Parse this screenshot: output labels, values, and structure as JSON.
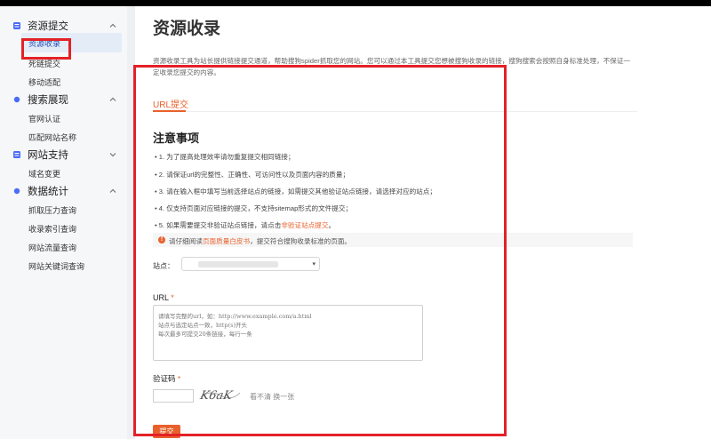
{
  "sidebar": {
    "groups": [
      {
        "title": "资源提交",
        "icon": "database-icon",
        "items": [
          "资源收录",
          "死链提交",
          "移动适配"
        ]
      },
      {
        "title": "搜索展现",
        "icon": "dot-icon",
        "items": [
          "官网认证",
          "匹配网站名称"
        ]
      },
      {
        "title": "网站支持",
        "icon": "database-icon",
        "items": [
          "域名变更"
        ]
      },
      {
        "title": "数据统计",
        "icon": "dot-icon",
        "items": [
          "抓取压力查询",
          "收录索引查询",
          "网站流量查询",
          "网站关键词查询"
        ]
      }
    ],
    "active_item": "资源收录"
  },
  "main": {
    "title": "资源收录",
    "intro_line1": "资源收录工具为站长提供链接提交通道，帮助搜狗spider抓取您的网站。您可以通过本工具提交您想被搜狗收录的链接，搜狗搜索会按照自身标准处理，不保证一",
    "intro_line2": "定收录您提交的内容。",
    "tab": "URL提交",
    "notes_title": "注意事项",
    "notes": [
      "• 1. 为了提高处理效率请勿重复提交相同链接；",
      "• 2. 请保证url的完整性、正确性、可访问性以及页面内容的质量；",
      "• 3. 请在输入框中填写当前选择站点的链接，如需提交其他验证站点链接，请选择对应的站点；",
      "• 4. 仅支持页面对应链接的提交，不支持sitemap形式的文件提交；"
    ],
    "note5_prefix": "• 5. 如果需要提交非验证站点链接，请点击",
    "note5_link": "非验证站点提交",
    "note5_suffix": "。",
    "warning_prefix": "请仔细阅读",
    "warning_link": "页面质量白皮书",
    "warning_suffix": "，提交符合搜狗收录标准的页面。",
    "site_label": "站点：",
    "url_label": "URL",
    "url_placeholder_lines": [
      "请填写完整的url，如：http://www.example.com/a.html",
      "站点与选定站点一致，http(s)开头",
      "每次最多可提交20条链接，每行一条"
    ],
    "captcha_label": "验证码",
    "captcha_text": "K6aK",
    "captcha_refresh": "看不清 换一张",
    "submit_label": "提交",
    "required_mark": "*"
  },
  "colors": {
    "accent": "#e8612c",
    "highlight_box": "#e32127",
    "sidebar_bg": "#f6f7f9",
    "icon_blue": "#4a6cf7"
  }
}
